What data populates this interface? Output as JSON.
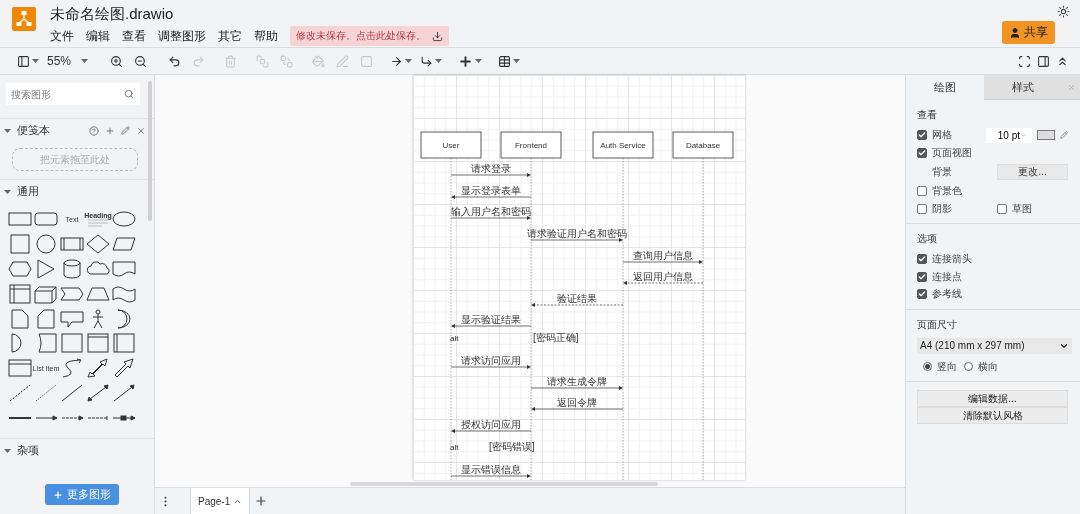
{
  "app": {
    "title": "未命名绘图.drawio",
    "menus": [
      "文件",
      "编辑",
      "查看",
      "调整图形",
      "其它",
      "帮助"
    ],
    "save_notice": "修改未保存。点击此处保存。",
    "share_button": "共享"
  },
  "toolbar": {
    "items": [
      {
        "kind": "layout",
        "disabled": false
      },
      {
        "kind": "zoom",
        "label": "55%",
        "disabled": false
      },
      {
        "kind": "zoom_in",
        "disabled": false
      },
      {
        "kind": "zoom_out",
        "disabled": false
      },
      {
        "kind": "undo",
        "disabled": false
      },
      {
        "kind": "redo",
        "disabled": true
      },
      {
        "kind": "delete",
        "disabled": true
      },
      {
        "kind": "to_front",
        "disabled": true
      },
      {
        "kind": "to_back",
        "disabled": true
      },
      {
        "kind": "fill",
        "disabled": true
      },
      {
        "kind": "line_color",
        "disabled": true
      },
      {
        "kind": "shadow",
        "disabled": true
      },
      {
        "kind": "connection",
        "disabled": false
      },
      {
        "kind": "waypoint",
        "disabled": false
      },
      {
        "kind": "insert",
        "disabled": false
      },
      {
        "kind": "table",
        "disabled": false
      }
    ],
    "right": [
      {
        "kind": "fullscreen"
      },
      {
        "kind": "format_panel"
      },
      {
        "kind": "collapse"
      }
    ]
  },
  "sidebar": {
    "search": {
      "placeholder": "搜索图形"
    },
    "scratchpad": {
      "title": "便笺本",
      "drop_hint": "把元素拖至此处"
    },
    "sections": [
      {
        "title": "通用"
      },
      {
        "title": "杂项"
      }
    ],
    "shape_labels": [
      "Text",
      "Heading",
      "List Item"
    ],
    "more_button": "更多图形"
  },
  "diagram": {
    "participants": [
      "User",
      "Frontend",
      "Auth Service",
      "Database"
    ],
    "messages": [
      {
        "label": "请求登录",
        "kind": "solid"
      },
      {
        "label": "显示登录表单",
        "kind": "solid"
      },
      {
        "label": "输入用户名和密码",
        "kind": "solid"
      },
      {
        "label": "请求验证用户名和密码",
        "kind": "solid"
      },
      {
        "label": "查询用户信息",
        "kind": "solid"
      },
      {
        "label": "返回用户信息",
        "kind": "dashed"
      },
      {
        "label": "验证结果",
        "kind": "dashed"
      },
      {
        "label": "显示验证结果",
        "kind": "solid"
      },
      {
        "label": "请求访问应用",
        "kind": "solid"
      },
      {
        "label": "请求生成令牌",
        "kind": "solid"
      },
      {
        "label": "返回令牌",
        "kind": "solid"
      },
      {
        "label": "授权访问应用",
        "kind": "solid"
      },
      {
        "label": "显示错误信息",
        "kind": "solid"
      }
    ],
    "fragments": [
      {
        "operator": "alt",
        "guard": "[密码正确]"
      },
      {
        "operator": "alt",
        "guard": "[密码错误]"
      }
    ]
  },
  "pages": [
    {
      "label": "Page-1",
      "selected": true
    }
  ],
  "format_panel": {
    "tabs": [
      {
        "label": "绘图",
        "selected": true
      },
      {
        "label": "样式",
        "selected": false
      }
    ],
    "view": {
      "title": "查看",
      "grid": {
        "label": "网格",
        "checked": true,
        "size": "10 pt"
      },
      "page_view": {
        "label": "页面视图",
        "checked": true
      },
      "background": {
        "label": "背景",
        "button": "更改..."
      },
      "background_color": {
        "label": "背景色",
        "checked": false
      },
      "shadow": {
        "label": "阴影",
        "checked": false
      },
      "sketch": {
        "label": "草图",
        "checked": false
      }
    },
    "options": {
      "title": "选项",
      "items": [
        {
          "label": "连接箭头",
          "checked": true
        },
        {
          "label": "连接点",
          "checked": true
        },
        {
          "label": "参考线",
          "checked": true
        }
      ]
    },
    "paper": {
      "title": "页面尺寸",
      "size": "A4 (210 mm x 297 mm)",
      "orientations": [
        {
          "label": "竖向",
          "selected": true
        },
        {
          "label": "横向",
          "selected": false
        }
      ]
    },
    "buttons": [
      "编辑数据...",
      "清除默认风格"
    ]
  }
}
